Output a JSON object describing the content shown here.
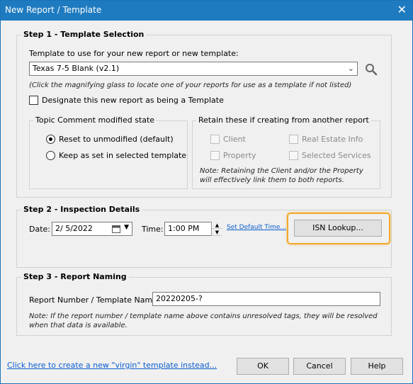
{
  "window": {
    "title": "New Report / Template",
    "close_glyph": "✕"
  },
  "step1": {
    "legend": "Step 1 - Template Selection",
    "template_label": "Template to use for your new report or new template:",
    "template_selected": "Texas 7-5 Blank (v2.1)",
    "template_hint": "(Click the magnifying glass to locate one of your reports for use as a template if not listed)",
    "designate_label": "Designate this new report as being a Template",
    "topic_group": {
      "legend": "Topic Comment modified state",
      "options": [
        {
          "label": "Reset to unmodified (default)",
          "selected": true
        },
        {
          "label": "Keep as set in selected template",
          "selected": false
        }
      ]
    },
    "retain_group": {
      "legend": "Retain these if creating from another report",
      "client": "Client",
      "property": "Property",
      "real_estate": "Real Estate Info",
      "selected_services": "Selected Services",
      "note": "Note: Retaining the Client and/or the Property will effectively link them to both reports."
    }
  },
  "step2": {
    "legend": "Step 2 - Inspection Details",
    "date_label": "Date:",
    "date_value": "2/  5/2022",
    "time_label": "Time:",
    "time_value": "1:00 PM",
    "set_default_link": "Set Default Time...",
    "isn_button": "ISN Lookup...",
    "highlight_color": "#f0a82a"
  },
  "step3": {
    "legend": "Step 3 - Report Naming",
    "name_label": "Report Number / Template Name:",
    "name_value": "20220205-?",
    "note": "Note: If the report number / template name above contains unresolved tags, they will be resolved when that data is available."
  },
  "footer": {
    "virgin_link": "Click here to create a new \"virgin\" template instead...",
    "ok": "OK",
    "cancel": "Cancel",
    "help": "Help"
  },
  "colors": {
    "titlebar": "#1f7bc0",
    "link": "#0b5fd0",
    "window_bg": "#f0f0f0"
  },
  "icons": {
    "magnifier": "search-icon",
    "calendar": "calendar-icon",
    "dropdown": "chevron-down-icon"
  }
}
